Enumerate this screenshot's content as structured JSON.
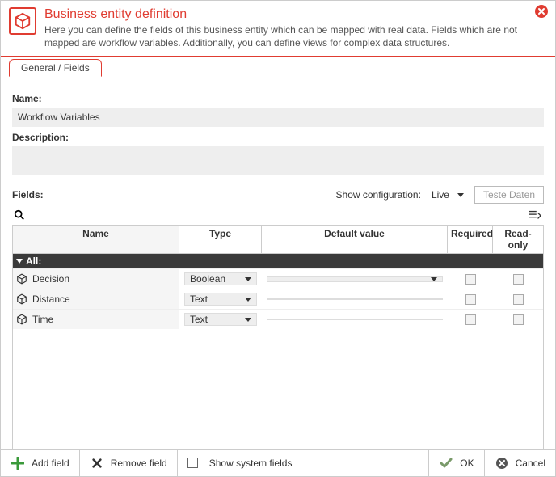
{
  "header": {
    "title": "Business entity definition",
    "description": "Here you can define the fields of this business entity which can be mapped with real data. Fields which are not mapped are workflow variables. Additionally, you can define views for complex data structures."
  },
  "tabs": [
    {
      "label": "General / Fields",
      "active": true
    }
  ],
  "form": {
    "name_label": "Name:",
    "name_value": "Workflow Variables",
    "description_label": "Description:",
    "description_value": ""
  },
  "fields_section": {
    "label": "Fields:",
    "show_config_label": "Show configuration:",
    "show_config_value": "Live",
    "test_data_button": "Teste Daten",
    "search_value": ""
  },
  "grid": {
    "columns": {
      "name": "Name",
      "type": "Type",
      "default": "Default value",
      "required": "Required",
      "readonly": "Read-only"
    },
    "group_label": "All:",
    "rows": [
      {
        "name": "Decision",
        "type": "Boolean",
        "default": "",
        "default_has_dropdown": true,
        "required": false,
        "readonly": false
      },
      {
        "name": "Distance",
        "type": "Text",
        "default": "",
        "default_has_dropdown": false,
        "required": false,
        "readonly": false
      },
      {
        "name": "Time",
        "type": "Text",
        "default": "",
        "default_has_dropdown": false,
        "required": false,
        "readonly": false
      }
    ]
  },
  "footer": {
    "add_field": "Add field",
    "remove_field": "Remove field",
    "show_system_fields": "Show system fields",
    "show_system_fields_checked": false,
    "ok": "OK",
    "cancel": "Cancel"
  },
  "colors": {
    "accent": "#e03c31"
  }
}
